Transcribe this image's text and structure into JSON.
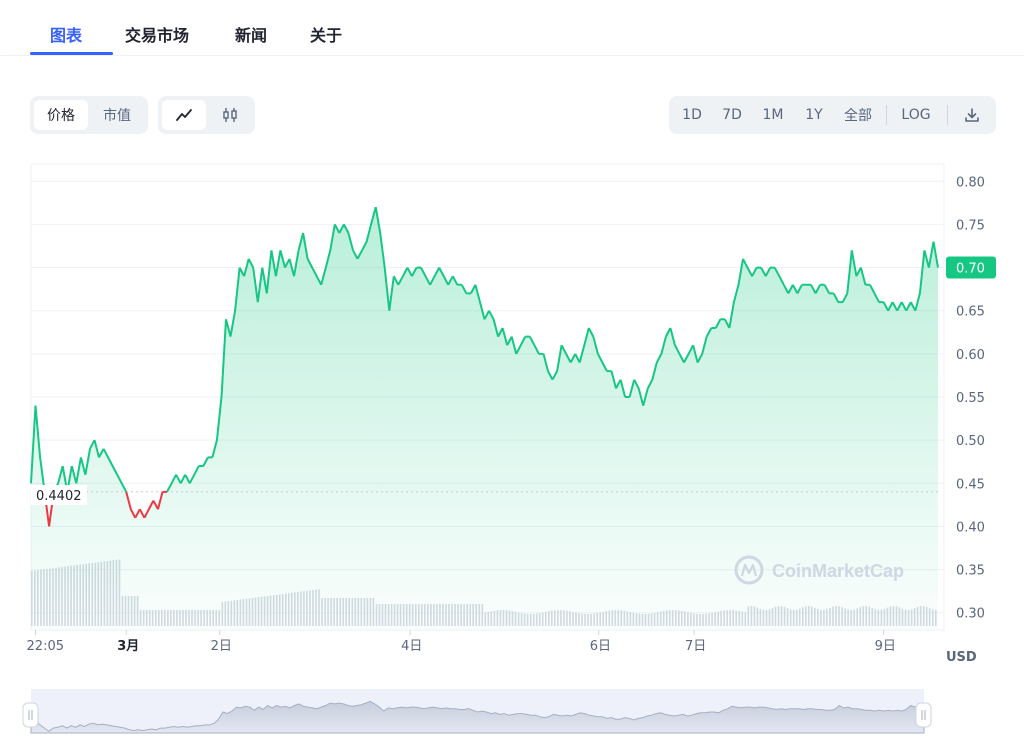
{
  "tabs": [
    {
      "label": "图表",
      "active": true
    },
    {
      "label": "交易市场",
      "active": false
    },
    {
      "label": "新闻",
      "active": false
    },
    {
      "label": "关于",
      "active": false
    }
  ],
  "toolbar": {
    "metric": {
      "price_label": "价格",
      "marketcap_label": "市值",
      "selected": "price"
    },
    "chart_kind": {
      "line_icon": "line-chart-icon",
      "candle_icon": "candlestick-icon",
      "selected": "line"
    },
    "ranges": [
      "1D",
      "7D",
      "1M",
      "1Y",
      "全部"
    ],
    "log_label": "LOG",
    "download_icon": "download-icon"
  },
  "watermark": {
    "brand": "CoinMarketCap",
    "icon": "coinmarketcap-logo-icon"
  },
  "colors": {
    "up": "#16c784",
    "down": "#ea3943",
    "accent": "#3861fb"
  },
  "chart_data": {
    "type": "line",
    "currency_label": "USD",
    "current_price_label": "0.70",
    "reference_price_label": "0.4402",
    "reference_price": 0.4402,
    "ylim": [
      0.28,
      0.82
    ],
    "y_ticks": [
      "0.80",
      "0.75",
      "0.70",
      "0.65",
      "0.60",
      "0.55",
      "0.50",
      "0.45",
      "0.40",
      "0.35",
      "0.30"
    ],
    "y_tick_values": [
      0.8,
      0.75,
      0.7,
      0.65,
      0.6,
      0.55,
      0.5,
      0.45,
      0.4,
      0.35,
      0.3
    ],
    "xlim": [
      0,
      100
    ],
    "x_ticks": [
      {
        "label": "22:05",
        "x": 0.5,
        "bold": false
      },
      {
        "label": "3月",
        "x": 10.5,
        "bold": true
      },
      {
        "label": "2日",
        "x": 20.8,
        "bold": false
      },
      {
        "label": "4日",
        "x": 41.8,
        "bold": false
      },
      {
        "label": "6日",
        "x": 62.6,
        "bold": false
      },
      {
        "label": "7日",
        "x": 73.1,
        "bold": false
      },
      {
        "label": "9日",
        "x": 94.0,
        "bold": false
      }
    ],
    "price": [
      [
        0,
        0.45
      ],
      [
        0.5,
        0.54
      ],
      [
        1,
        0.48
      ],
      [
        1.5,
        0.44
      ],
      [
        2,
        0.4
      ],
      [
        2.5,
        0.44
      ],
      [
        3,
        0.45
      ],
      [
        3.5,
        0.47
      ],
      [
        4,
        0.44
      ],
      [
        4.5,
        0.47
      ],
      [
        5,
        0.45
      ],
      [
        5.5,
        0.48
      ],
      [
        6,
        0.46
      ],
      [
        6.5,
        0.49
      ],
      [
        7,
        0.5
      ],
      [
        7.5,
        0.48
      ],
      [
        8,
        0.49
      ],
      [
        8.5,
        0.48
      ],
      [
        9,
        0.47
      ],
      [
        9.5,
        0.46
      ],
      [
        10,
        0.45
      ],
      [
        10.5,
        0.44
      ],
      [
        11,
        0.42
      ],
      [
        11.5,
        0.41
      ],
      [
        12,
        0.42
      ],
      [
        12.5,
        0.41
      ],
      [
        13,
        0.42
      ],
      [
        13.5,
        0.43
      ],
      [
        14,
        0.42
      ],
      [
        14.5,
        0.44
      ],
      [
        15,
        0.44
      ],
      [
        15.5,
        0.45
      ],
      [
        16,
        0.46
      ],
      [
        16.5,
        0.45
      ],
      [
        17,
        0.46
      ],
      [
        17.5,
        0.45
      ],
      [
        18,
        0.46
      ],
      [
        18.5,
        0.47
      ],
      [
        19,
        0.47
      ],
      [
        19.5,
        0.48
      ],
      [
        20,
        0.48
      ],
      [
        20.5,
        0.5
      ],
      [
        21,
        0.55
      ],
      [
        21.5,
        0.64
      ],
      [
        22,
        0.62
      ],
      [
        22.5,
        0.65
      ],
      [
        23,
        0.7
      ],
      [
        23.5,
        0.69
      ],
      [
        24,
        0.71
      ],
      [
        24.5,
        0.7
      ],
      [
        25,
        0.66
      ],
      [
        25.5,
        0.7
      ],
      [
        26,
        0.67
      ],
      [
        26.5,
        0.72
      ],
      [
        27,
        0.69
      ],
      [
        27.5,
        0.72
      ],
      [
        28,
        0.7
      ],
      [
        28.5,
        0.71
      ],
      [
        29,
        0.69
      ],
      [
        29.5,
        0.72
      ],
      [
        30,
        0.74
      ],
      [
        30.5,
        0.71
      ],
      [
        31,
        0.7
      ],
      [
        31.5,
        0.69
      ],
      [
        32,
        0.68
      ],
      [
        32.5,
        0.7
      ],
      [
        33,
        0.72
      ],
      [
        33.5,
        0.75
      ],
      [
        34,
        0.74
      ],
      [
        34.5,
        0.75
      ],
      [
        35,
        0.74
      ],
      [
        35.5,
        0.72
      ],
      [
        36,
        0.71
      ],
      [
        36.5,
        0.72
      ],
      [
        37,
        0.73
      ],
      [
        37.5,
        0.75
      ],
      [
        38,
        0.77
      ],
      [
        38.5,
        0.74
      ],
      [
        39,
        0.7
      ],
      [
        39.5,
        0.65
      ],
      [
        40,
        0.69
      ],
      [
        40.5,
        0.68
      ],
      [
        41,
        0.69
      ],
      [
        41.5,
        0.7
      ],
      [
        42,
        0.69
      ],
      [
        42.5,
        0.7
      ],
      [
        43,
        0.7
      ],
      [
        43.5,
        0.69
      ],
      [
        44,
        0.68
      ],
      [
        44.5,
        0.69
      ],
      [
        45,
        0.7
      ],
      [
        45.5,
        0.69
      ],
      [
        46,
        0.68
      ],
      [
        46.5,
        0.69
      ],
      [
        47,
        0.68
      ],
      [
        47.5,
        0.68
      ],
      [
        48,
        0.67
      ],
      [
        48.5,
        0.67
      ],
      [
        49,
        0.68
      ],
      [
        49.5,
        0.66
      ],
      [
        50,
        0.64
      ],
      [
        50.5,
        0.65
      ],
      [
        51,
        0.64
      ],
      [
        51.5,
        0.62
      ],
      [
        52,
        0.63
      ],
      [
        52.5,
        0.61
      ],
      [
        53,
        0.62
      ],
      [
        53.5,
        0.6
      ],
      [
        54,
        0.61
      ],
      [
        54.5,
        0.62
      ],
      [
        55,
        0.62
      ],
      [
        55.5,
        0.61
      ],
      [
        56,
        0.6
      ],
      [
        56.5,
        0.6
      ],
      [
        57,
        0.58
      ],
      [
        57.5,
        0.57
      ],
      [
        58,
        0.58
      ],
      [
        58.5,
        0.61
      ],
      [
        59,
        0.6
      ],
      [
        59.5,
        0.59
      ],
      [
        60,
        0.6
      ],
      [
        60.5,
        0.59
      ],
      [
        61,
        0.61
      ],
      [
        61.5,
        0.63
      ],
      [
        62,
        0.62
      ],
      [
        62.5,
        0.6
      ],
      [
        63,
        0.59
      ],
      [
        63.5,
        0.58
      ],
      [
        64,
        0.58
      ],
      [
        64.5,
        0.56
      ],
      [
        65,
        0.57
      ],
      [
        65.5,
        0.55
      ],
      [
        66,
        0.55
      ],
      [
        66.5,
        0.57
      ],
      [
        67,
        0.56
      ],
      [
        67.5,
        0.54
      ],
      [
        68,
        0.56
      ],
      [
        68.5,
        0.57
      ],
      [
        69,
        0.59
      ],
      [
        69.5,
        0.6
      ],
      [
        70,
        0.62
      ],
      [
        70.5,
        0.63
      ],
      [
        71,
        0.61
      ],
      [
        71.5,
        0.6
      ],
      [
        72,
        0.59
      ],
      [
        72.5,
        0.6
      ],
      [
        73,
        0.61
      ],
      [
        73.5,
        0.59
      ],
      [
        74,
        0.6
      ],
      [
        74.5,
        0.62
      ],
      [
        75,
        0.63
      ],
      [
        75.5,
        0.63
      ],
      [
        76,
        0.64
      ],
      [
        76.5,
        0.64
      ],
      [
        77,
        0.63
      ],
      [
        77.5,
        0.66
      ],
      [
        78,
        0.68
      ],
      [
        78.5,
        0.71
      ],
      [
        79,
        0.7
      ],
      [
        79.5,
        0.69
      ],
      [
        80,
        0.7
      ],
      [
        80.5,
        0.7
      ],
      [
        81,
        0.69
      ],
      [
        81.5,
        0.7
      ],
      [
        82,
        0.7
      ],
      [
        82.5,
        0.69
      ],
      [
        83,
        0.68
      ],
      [
        83.5,
        0.67
      ],
      [
        84,
        0.68
      ],
      [
        84.5,
        0.67
      ],
      [
        85,
        0.68
      ],
      [
        85.5,
        0.68
      ],
      [
        86,
        0.68
      ],
      [
        86.5,
        0.67
      ],
      [
        87,
        0.68
      ],
      [
        87.5,
        0.68
      ],
      [
        88,
        0.67
      ],
      [
        88.5,
        0.67
      ],
      [
        89,
        0.66
      ],
      [
        89.5,
        0.66
      ],
      [
        90,
        0.67
      ],
      [
        90.5,
        0.72
      ],
      [
        91,
        0.69
      ],
      [
        91.5,
        0.7
      ],
      [
        92,
        0.68
      ],
      [
        92.5,
        0.68
      ],
      [
        93,
        0.67
      ],
      [
        93.5,
        0.66
      ],
      [
        94,
        0.66
      ],
      [
        94.5,
        0.65
      ],
      [
        95,
        0.66
      ],
      [
        95.5,
        0.65
      ],
      [
        96,
        0.66
      ],
      [
        96.5,
        0.65
      ],
      [
        97,
        0.66
      ],
      [
        97.5,
        0.65
      ],
      [
        98,
        0.67
      ],
      [
        98.5,
        0.72
      ],
      [
        99,
        0.7
      ],
      [
        99.5,
        0.73
      ],
      [
        100,
        0.7
      ]
    ]
  }
}
